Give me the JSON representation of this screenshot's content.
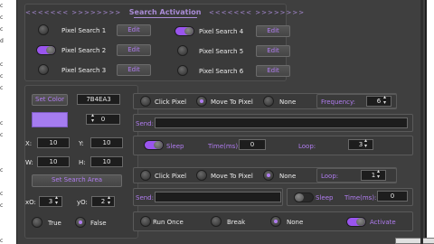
{
  "background_letters": [
    "c",
    "c",
    "c",
    "d",
    "",
    "c",
    "c",
    "c",
    "",
    "",
    "c",
    "c",
    "",
    "",
    "c",
    "",
    "c",
    "c",
    "",
    "",
    "c"
  ],
  "title": {
    "left_arrows": "<<<<<<<   >>>>>>>>",
    "text": "Search Activation",
    "right_arrows": "<<<<<<<   >>>>>>>>"
  },
  "pixel_searches": [
    {
      "label": "Pixel Search 1",
      "edit": "Edit",
      "active": false
    },
    {
      "label": "Pixel Search 2",
      "edit": "Edit",
      "active": true
    },
    {
      "label": "Pixel Search 3",
      "edit": "Edit",
      "active": false
    },
    {
      "label": "Pixel Search 4",
      "edit": "Edit",
      "active": true
    },
    {
      "label": "Pixel Search 5",
      "edit": "Edit",
      "active": false
    },
    {
      "label": "Pixel Search 6",
      "edit": "Edit",
      "active": false
    }
  ],
  "left": {
    "set_color": "Set Color",
    "color_hex": "7B4EA3",
    "swatch_color": "#a57cf0",
    "variation": "0",
    "x_label": "X:",
    "x_value": "10",
    "y_label": "Y:",
    "y_value": "10",
    "w_label": "W:",
    "w_value": "10",
    "h_label": "H:",
    "h_value": "10",
    "set_search_area": "Set Search Area",
    "xo_label": "xO:",
    "xo_value": "3",
    "yo_label": "yO:",
    "yo_value": "2",
    "true_label": "True",
    "false_label": "False",
    "selected": "False"
  },
  "action1": {
    "click_pixel": "Click Pixel",
    "move_to_pixel": "Move To Pixel",
    "none": "None",
    "selected": "Move To Pixel",
    "frequency_label": "Frequency:",
    "frequency_value": "6",
    "send_label": "Send:",
    "send_value": "",
    "sleep_label": "Sleep",
    "sleep_on": true,
    "time_label": "Time(ms):",
    "time_value": "0",
    "loop_label": "Loop:",
    "loop_value": "3"
  },
  "action2": {
    "click_pixel": "Click Pixel",
    "move_to_pixel": "Move To Pixel",
    "none": "None",
    "selected": "None",
    "loop_label": "Loop:",
    "loop_value": "1",
    "send_label": "Send:",
    "send_value": "",
    "sleep_label": "Sleep",
    "sleep_on": false,
    "time_label": "Time(ms):",
    "time_value": "0"
  },
  "bottom": {
    "run_once": "Run Once",
    "break": "Break",
    "none": "None",
    "selected": "None",
    "activate": "Activate",
    "activate_on": true
  },
  "accent": "#b07cf0"
}
